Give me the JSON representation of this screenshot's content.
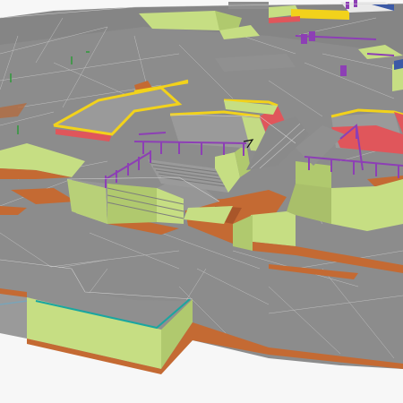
{
  "view": {
    "type": "3d-terrain-mesh",
    "interface_text": "none",
    "colors": {
      "background": "#f7f7f7",
      "ground": "#8c8c8c",
      "ground_dark": "#7a7a7a",
      "wall_light": "#c6de83",
      "wall_mid": "#b0c96e",
      "soil": "#c46a33",
      "soil_dark": "#a9562a",
      "rail": "#8d3fb5",
      "curb_yellow": "#f2d21b",
      "red_face": "#e0565b",
      "teal_edge": "#1aa6a0",
      "edge": "#d6d6d6"
    },
    "features": [
      "terrain",
      "walls",
      "stairs",
      "railings",
      "curbs",
      "soil",
      "bollards"
    ]
  }
}
